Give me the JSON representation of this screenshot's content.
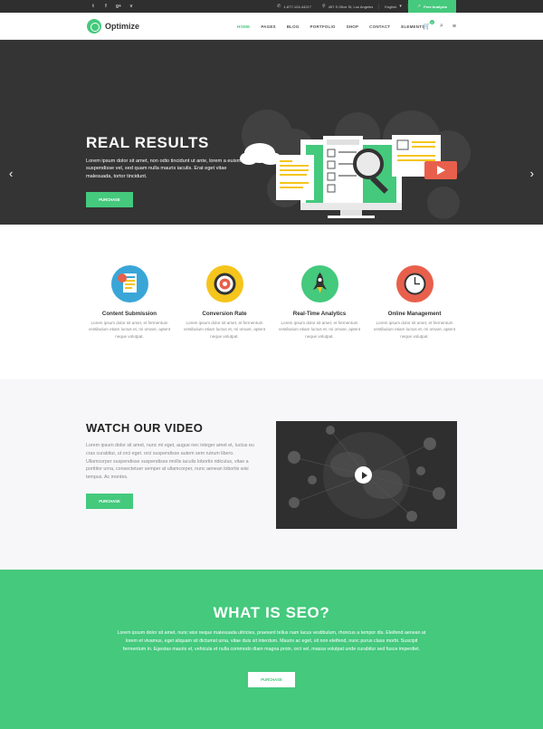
{
  "topbar": {
    "social": [
      "t",
      "f",
      "g+",
      "v"
    ],
    "phone": "1-877-124-44217",
    "address": "457 S Olive St, Los Angeles",
    "language": "English",
    "free_analysis": "Free Analysis"
  },
  "brand": {
    "name": "Optimize",
    "accent": "#44c97d"
  },
  "nav": {
    "items": [
      "HOME",
      "PAGES",
      "BLOG",
      "PORTFOLIO",
      "SHOP",
      "CONTACT",
      "ELEMENTS"
    ],
    "active": "HOME",
    "cart_count": "0"
  },
  "hero": {
    "title": "REAL RESULTS",
    "text": "Lorem ipsum dolor sit amet, non odio tincidunt ut ante, lorem a euismod suspendisse vel, sed quam nulla mauris iaculis. Erat eget vitae malesuada, tortor tincidunt.",
    "button": "PURCHASE"
  },
  "features": [
    {
      "title": "Content Submission",
      "text": "Lorem ipsum dolor sit amet, et fermentum vestibulum etiam luctus et, mi ornare, aptent neque volutpat.",
      "icon": "document-icon",
      "color": "#3aa6d8"
    },
    {
      "title": "Conversion Rate",
      "text": "Lorem ipsum dolor sit amet, et fermentum vestibulum etiam luctus et, mi ornare, aptent neque volutpat.",
      "icon": "target-icon",
      "color": "#f5c51c"
    },
    {
      "title": "Real-Time Analytics",
      "text": "Lorem ipsum dolor sit amet, et fermentum vestibulum etiam luctus et, mi ornare, aptent neque volutpat.",
      "icon": "rocket-icon",
      "color": "#44c97d"
    },
    {
      "title": "Online Management",
      "text": "Lorem ipsum dolor sit amet, et fermentum vestibulum etiam luctus et, mi ornare, aptent neque volutpat.",
      "icon": "clock-icon",
      "color": "#e8604c"
    }
  ],
  "video": {
    "title": "WATCH OUR VIDEO",
    "text": "Lorem ipsum dolor sit amet, nunc mi eget, augue nec integer amet et, luctus eu cras curabitur, ut orci eget. orci suspendisse autem sem rutrum libero. Ullamcorper suspendisse suspendisse mollis iaculis lobortis ridiculus, vitae a porttitor urna, consectetuer semper at ullamcorper, nunc aenean lobortis wisi tempus. Ac montes.",
    "button": "PURCHASE"
  },
  "seo": {
    "title": "WHAT IS SEO?",
    "text": "Lorem ipsum dolor sit amet, nunc wisi neque malesuada ultricies, praesent tellus nam lacus vestibulum, rhoncus a tempor dis. Eleifend aenean at lorem et vivamus, eget aliquam sit dictumst urna, vitae duis sit interdum. Mauris ac eget, sit non eleifend, nunc purus class morbi. Suscipit fermentum in. Egestas mauris et, vehicula et nulla commodo diam magna proin, orci vel, massa volutpat unde curabitur sed fusce imperdiet.",
    "button": "PURCHASE"
  }
}
